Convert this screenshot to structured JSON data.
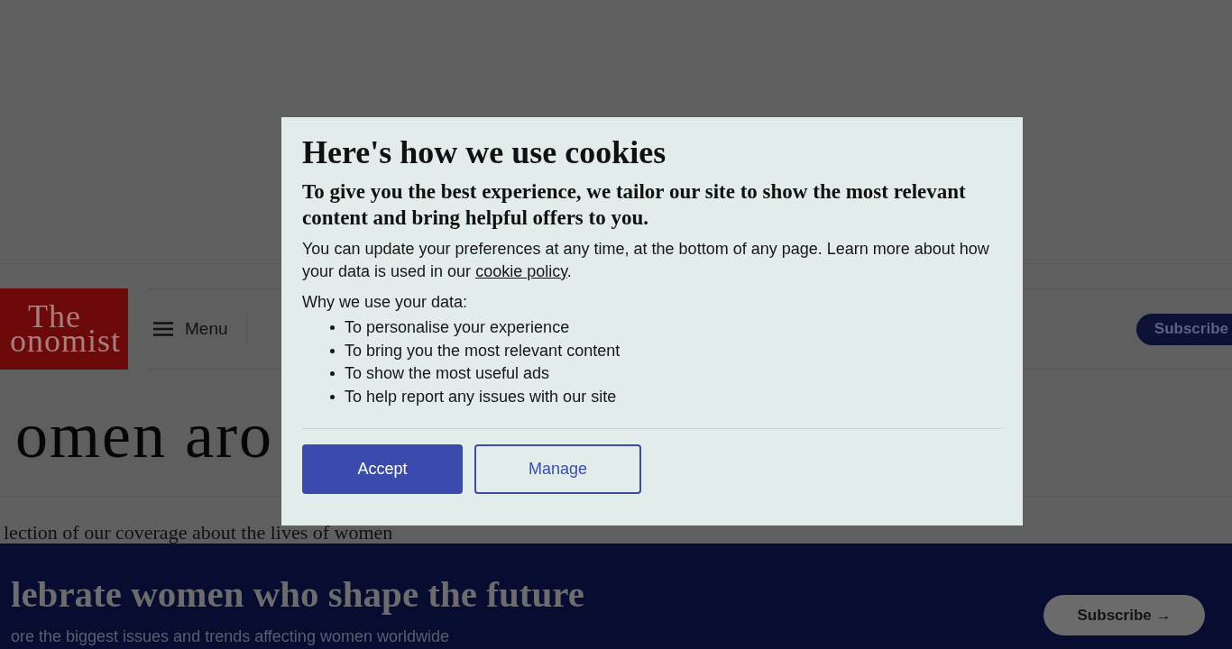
{
  "header": {
    "logo": {
      "lines": [
        "The",
        "onomist"
      ]
    },
    "menu_button": {
      "label": "Menu"
    },
    "subscribe_button": {
      "label": "Subscribe"
    }
  },
  "page": {
    "title": "omen aro",
    "subtitle": "lection of our coverage about the lives of women"
  },
  "promo_banner": {
    "heading": "lebrate women who shape the future",
    "text": "ore the biggest issues and trends affecting women worldwide",
    "button": {
      "label": "Subscribe →"
    }
  },
  "cookie_dialog": {
    "title": "Here's how we use cookies",
    "lead": "To give you the best experience, we tailor our site to show the most relevant content and bring helpful offers to you.",
    "body_before_link": "You can update your preferences at any time, at the bottom of any page. Learn more about how your data is used in our ",
    "link": "cookie policy",
    "body_after_link": ".",
    "list_heading": "Why we use your data:",
    "reasons": [
      "To personalise your experience",
      "To bring you the most relevant content",
      "To show the most useful ads",
      "To help report any issues with our site"
    ],
    "buttons": [
      {
        "label": "Accept",
        "kind": "primary"
      },
      {
        "label": "Manage",
        "kind": "secondary"
      }
    ]
  }
}
